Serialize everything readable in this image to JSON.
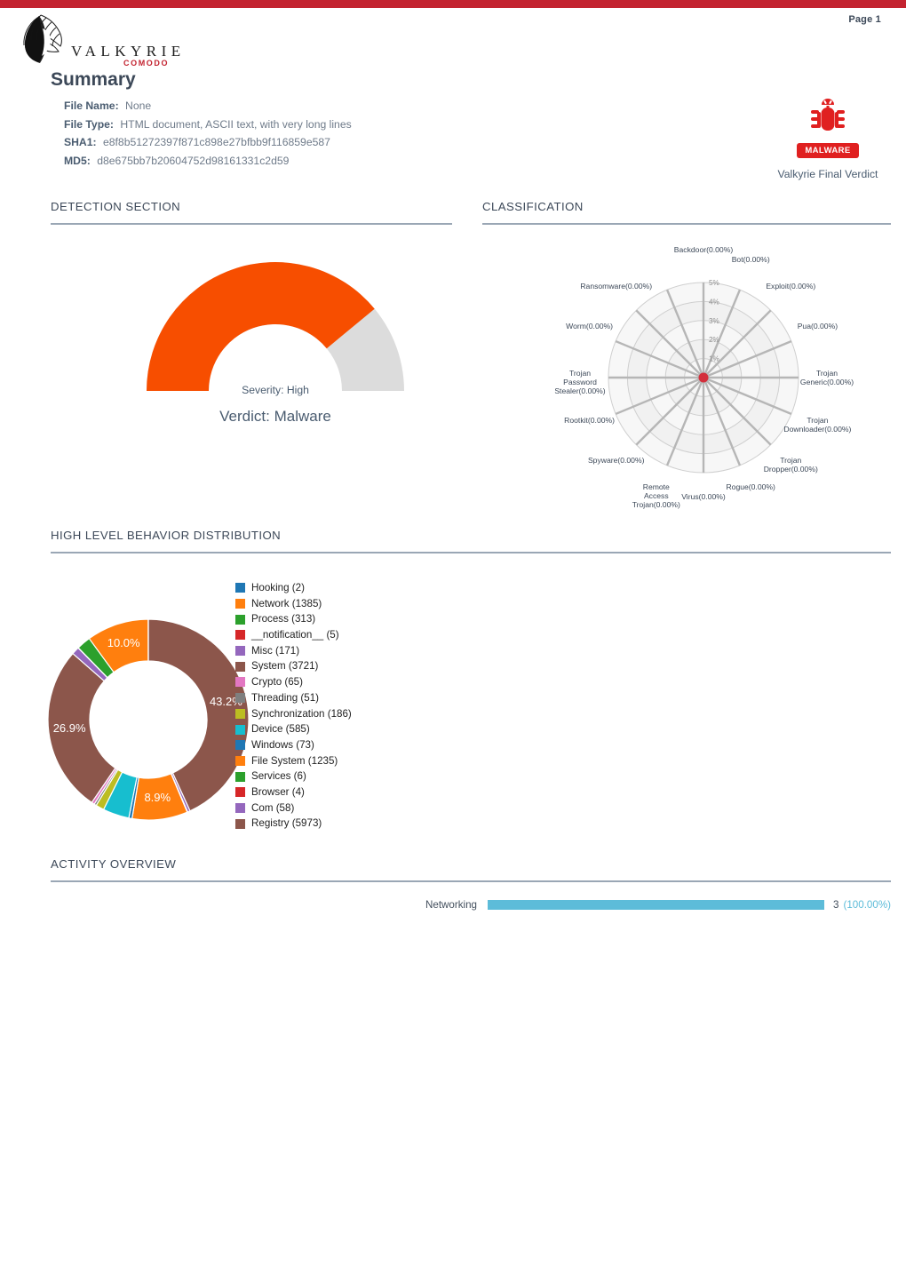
{
  "page": {
    "page_label": "Page 1",
    "accent_red": "#c32330"
  },
  "brand": {
    "name": "VALKYRIE",
    "sub": "COMODO",
    "logo_icon": "valkyrie-wing-logo"
  },
  "summary": {
    "title": "Summary",
    "fields": [
      {
        "label": "File Name:",
        "value": "None"
      },
      {
        "label": "File Type:",
        "value": "HTML document, ASCII text, with very long lines"
      },
      {
        "label": "SHA1:",
        "value": "e8f8b51272397f871c898e27bfbb9f116859e587"
      },
      {
        "label": "MD5:",
        "value": "d8e675bb7b20604752d98161331c2d59"
      }
    ]
  },
  "verdict": {
    "icon": "bug-icon",
    "badge": "MALWARE",
    "badge_color": "#e02020",
    "caption": "Valkyrie Final Verdict"
  },
  "sections": {
    "detection": "DETECTION SECTION",
    "classification": "CLASSIFICATION",
    "behavior": "HIGH LEVEL BEHAVIOR DISTRIBUTION",
    "activity": "ACTIVITY OVERVIEW"
  },
  "gauge": {
    "severity_text": "Severity: High",
    "verdict_text": "Verdict: Malware",
    "fill_fraction": 0.78,
    "fill_color": "#f74e00",
    "track_color": "#dcdcdc"
  },
  "chart_data": [
    {
      "type": "radar",
      "title": "CLASSIFICATION",
      "tick_labels": [
        "1%",
        "2%",
        "3%",
        "4%",
        "5%"
      ],
      "rlim": [
        0,
        5
      ],
      "grid": true,
      "center_marker_color": "#d32f3c",
      "categories": [
        "Backdoor(0.00%)",
        "Bot(0.00%)",
        "Exploit(0.00%)",
        "Pua(0.00%)",
        "Trojan\nGeneric(0.00%)",
        "Trojan\nDownloader(0.00%)",
        "Trojan\nDropper(0.00%)",
        "Rogue(0.00%)",
        "Virus(0.00%)",
        "Remote\nAccess\nTrojan(0.00%)",
        "Spyware(0.00%)",
        "Rootkit(0.00%)",
        "Trojan\nPassword\nStealer(0.00%)",
        "Worm(0.00%)",
        "Ransomware(0.00%)"
      ],
      "values": [
        0,
        0,
        0,
        0,
        0,
        0,
        0,
        0,
        0,
        0,
        0,
        0,
        0,
        0,
        0
      ]
    },
    {
      "type": "pie",
      "title": "HIGH LEVEL BEHAVIOR DISTRIBUTION",
      "donut": true,
      "legend_position": "right",
      "labels": [
        "Hooking (2)",
        "Network (1385)",
        "Process (313)",
        "__notification__ (5)",
        "Misc (171)",
        "System (3721)",
        "Crypto (65)",
        "Threading (51)",
        "Synchronization (186)",
        "Device (585)",
        "Windows (73)",
        "File System (1235)",
        "Services (6)",
        "Browser (4)",
        "Com (58)",
        "Registry (5973)"
      ],
      "values": [
        2,
        1385,
        313,
        5,
        171,
        3721,
        65,
        51,
        186,
        585,
        73,
        1235,
        6,
        4,
        58,
        5973
      ],
      "colors": [
        "#1f77b4",
        "#ff7f0e",
        "#2ca02c",
        "#d62728",
        "#9467bd",
        "#8c564b",
        "#e377c2",
        "#7f7f7f",
        "#bcbd22",
        "#17becf",
        "#1f77b4",
        "#ff7f0e",
        "#2ca02c",
        "#d62728",
        "#9467bd",
        "#8c564b"
      ],
      "visible_percent_labels": [
        "43.2%",
        "26.9%",
        "10.0%",
        "8.9%"
      ]
    },
    {
      "type": "bar",
      "title": "ACTIVITY OVERVIEW",
      "orientation": "horizontal",
      "categories": [
        "Networking"
      ],
      "values": [
        3
      ],
      "percent_labels": [
        "(100.00%)"
      ],
      "bar_color": "#5dbcd9"
    }
  ]
}
